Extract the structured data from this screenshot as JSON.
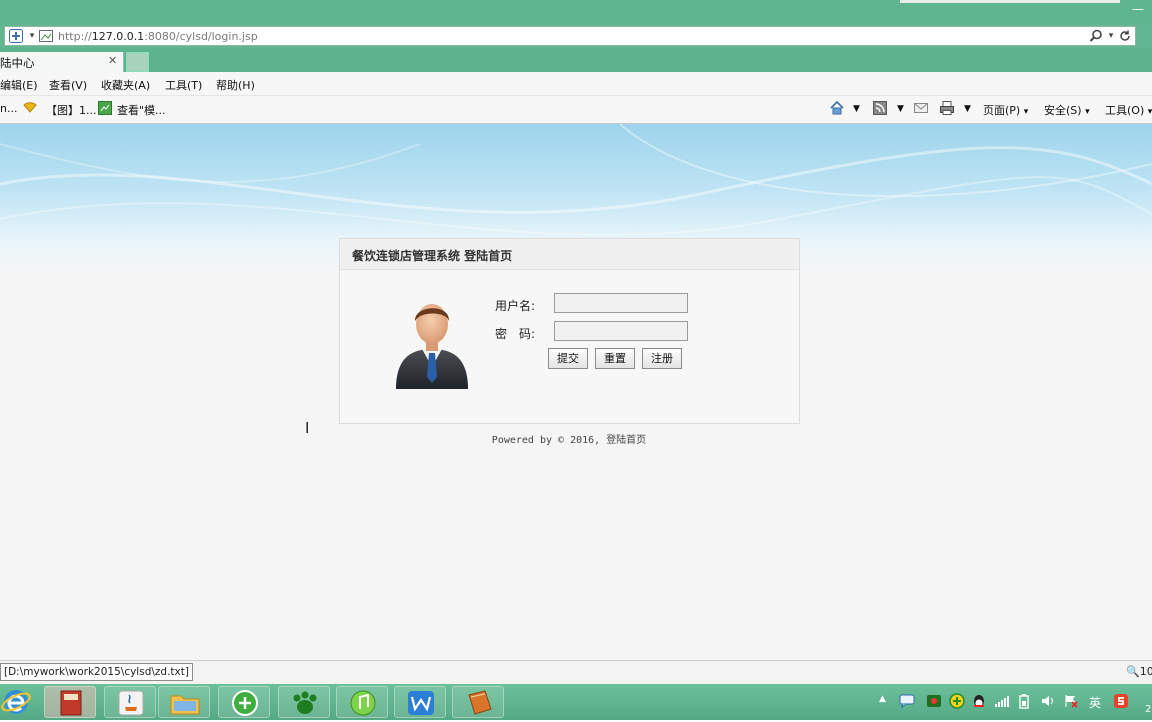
{
  "browser": {
    "address_prefix": "http://",
    "address_host": "127.0.0.1",
    "address_rest": ":8080/cylsd/login.jsp",
    "tab_label": "陆中心",
    "menu": [
      "编辑(E)",
      "查看(V)",
      "收藏夹(A)",
      "工具(T)",
      "帮助(H)"
    ],
    "favorites": [
      "n...",
      "【图】1...",
      "查看\"模..."
    ],
    "commands": [
      "页面(P)",
      "安全(S)",
      "工具(O)"
    ],
    "status_tip": "[D:\\mywork\\work2015\\cylsd\\zd.txt]",
    "zoom_label": "10"
  },
  "login": {
    "title": "餐饮连锁店管理系统  登陆首页",
    "username_label": "用户名:",
    "username_value": "",
    "password_label": "密　码:",
    "password_value": "",
    "submit_label": "提交",
    "reset_label": "重置",
    "register_label": "注册"
  },
  "footer": {
    "text": "Powered by © 2016, ",
    "link": "登陆首页"
  },
  "taskbar": {
    "tray_lang": "英",
    "tray_clock": "2"
  },
  "colors": {
    "chrome_green": "#5fb58f",
    "banner_blue": "#9dd4ec",
    "panel_bg": "#f7f7f7"
  }
}
